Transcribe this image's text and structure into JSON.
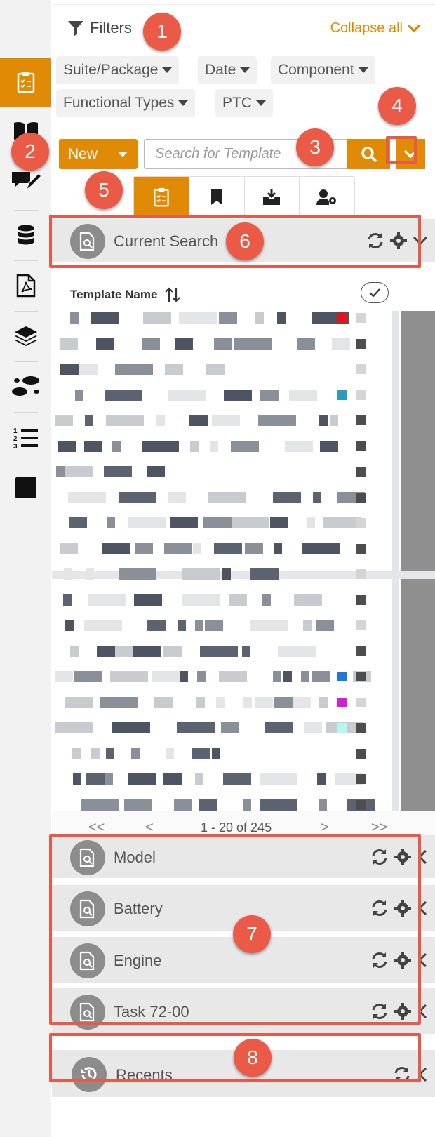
{
  "filters": {
    "title": "Filters",
    "collapse_all": "Collapse all",
    "chips": [
      "Suite/Package",
      "Date",
      "Component",
      "Functional Types",
      "PTC"
    ]
  },
  "toolbar": {
    "new_label": "New",
    "search_placeholder": "Search for Template"
  },
  "tabs": [
    "checklist-icon",
    "bookmark-icon",
    "inbox-download-icon",
    "user-settings-icon"
  ],
  "current_search": {
    "label": "Current Search"
  },
  "table": {
    "column_name": "Template Name"
  },
  "pagination": {
    "first": "<<",
    "prev": "<",
    "range": "1 - 20 of 245",
    "next": ">",
    "last": ">>"
  },
  "saved_searches": [
    {
      "label": "Model"
    },
    {
      "label": "Battery"
    },
    {
      "label": "Engine"
    },
    {
      "label": "Task 72-00"
    }
  ],
  "recents": {
    "label": "Recents"
  },
  "annotations": [
    "1",
    "2",
    "3",
    "4",
    "5",
    "6",
    "7",
    "8"
  ],
  "colors": {
    "accent": "#e18a06",
    "annotation": "#ea5a47",
    "row_bg": "#e8e8e8"
  },
  "rail_icons": [
    "checklist-icon",
    "book-icon",
    "comment-edit-icon",
    "database-icon",
    "pdf-icon",
    "layers-icon",
    "footsteps-icon",
    "numbered-list-icon",
    "square-icon"
  ]
}
